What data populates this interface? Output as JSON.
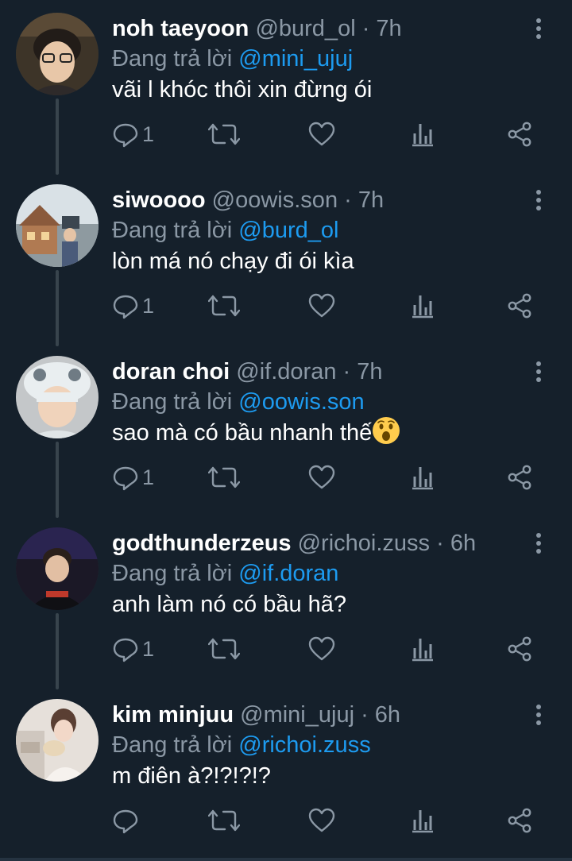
{
  "reply_prefix": "Đang trả lời",
  "replies": [
    {
      "name": "noh taeyoon",
      "handle": "@burd_ol",
      "time": "· 7h",
      "reply_to": "@mini_ujuj",
      "text": "vãi l khóc thôi xin đừng ói",
      "reply_count": "1"
    },
    {
      "name": "siwoooo",
      "handle": "@oowis.son",
      "time": "· 7h",
      "reply_to": "@burd_ol",
      "text": "lòn má nó chạy đi ói kìa",
      "reply_count": "1"
    },
    {
      "name": "doran choi",
      "handle": "@if.doran",
      "time": "· 7h",
      "reply_to": "@oowis.son",
      "text": "sao mà có bầu nhanh thế",
      "reply_count": "1"
    },
    {
      "name": "godthunderzeus",
      "handle": "@richoi.zuss",
      "time": "· 6h",
      "reply_to": "@if.doran",
      "text": "anh làm nó có bầu hã?",
      "reply_count": "1"
    },
    {
      "name": "kim minjuu",
      "handle": "@mini_ujuj",
      "time": "· 6h",
      "reply_to": "@richoi.zuss",
      "text": "m điên à?!?!?!?",
      "reply_count": ""
    }
  ],
  "icons": {
    "reply": "comment-icon",
    "retweet": "retweet-icon",
    "like": "heart-icon",
    "views": "analytics-icon",
    "share": "share-icon",
    "more": "more-vertical-icon",
    "emoji": "astonished-face-emoji"
  },
  "colors": {
    "background": "#15202b",
    "text": "#ffffff",
    "secondary": "#8b98a5",
    "mention": "#1d9bf0",
    "thread_line": "#38444d"
  }
}
